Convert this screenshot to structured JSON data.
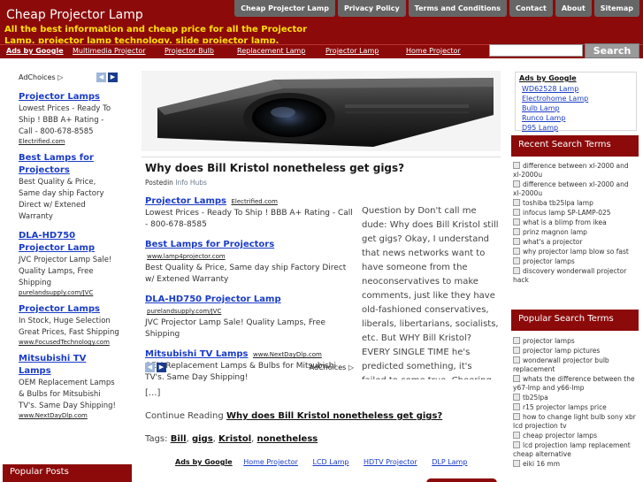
{
  "header": {
    "site_title": "Cheap Projector Lamp",
    "tagline": "All the best information and cheap price for all the Projector Lamp, projector lamp technology, slide projector lamp.",
    "top_nav": [
      "Cheap Projector Lamp",
      "Privacy Policy",
      "Terms and Conditions",
      "Contact",
      "About",
      "Sitemap"
    ]
  },
  "navbar": {
    "ads_label": "Ads by Google",
    "items": [
      "Multimedia Projector",
      "Projector Bulb",
      "Replacement Lamp",
      "Projector Lamp",
      "Home Projector"
    ],
    "search_button": "Search"
  },
  "left_sidebar": {
    "adchoices": "AdChoices",
    "arrows": [
      "◀",
      "▶"
    ],
    "ads": [
      {
        "title": "Projector Lamps",
        "body": "Lowest Prices - Ready To Ship ! BBB A+ Rating - Call - 800-678-8585",
        "url": "Electrified.com"
      },
      {
        "title": "Best Lamps for Projectors",
        "body": "Best Quality & Price, Same day ship Factory Direct w/ Extened Warranty",
        "url": ""
      },
      {
        "title": "DLA-HD750 Projector Lamp",
        "body": "JVC Projector Lamp Sale! Quality Lamps, Free Shipping",
        "url": "purelandsupply.com/JVC"
      },
      {
        "title": "Projector Lamps",
        "body": "In Stock, Huge Selection Great Prices, Fast Shipping",
        "url": "www.FocusedTechnology.com"
      },
      {
        "title": "Mitsubishi TV Lamps",
        "body": "OEM Replacement Lamps & Bulbs for Mitsubishi TV's. Same Day Shipping!",
        "url": "www.NextDayDlp.com"
      }
    ],
    "popular_posts": "Popular Posts"
  },
  "post": {
    "title": "Why does Bill Kristol nonetheless get gigs?",
    "posted_in_label": "Postedin",
    "category": "Info Hubs",
    "body": "Question by Don't call me dude: Why does Bill Kristol still get gigs? Okay, I understand that news networks want to have someone from the neoconservatives to make comments, just like they have old-fashioned conservatives, liberals, libertarians, socialists, etc. But WHY Bill Kristol? EVERY SINGLE TIME he's predicted something, it's failed to come true. Cheering",
    "ellipsis": "[...]",
    "continue_label": "Continue Reading",
    "continue_link": "Why does Bill Kristol nonetheless get gigs?",
    "tags_label": "Tags:",
    "tags": [
      "Bill",
      "gigs",
      "Kristol",
      "nonetheless"
    ]
  },
  "inline_ads": {
    "ads": [
      {
        "title": "Projector Lamps",
        "url": "Electrified.com",
        "body": "Lowest Prices - Ready To Ship ! BBB A+ Rating - Call - 800-678-8585"
      },
      {
        "title": "Best Lamps for Projectors",
        "url": "www.lamp4projector.com",
        "body": "Best Quality & Price, Same day ship Factory Direct w/ Extened Warranty"
      },
      {
        "title": "DLA-HD750 Projector Lamp",
        "url": "purelandsupply.com/JVC",
        "body": "JVC Projector Lamp Sale! Quality Lamps, Free Shipping"
      },
      {
        "title": "Mitsubishi TV Lamps",
        "url": "www.NextDayDlp.com",
        "body": "OEM Replacement Lamps & Bulbs for Mitsubishi TV's. Same Day Shipping!"
      }
    ],
    "adchoices": "AdChoices"
  },
  "bottom_links": {
    "ads_label": "Ads by Google",
    "items": [
      "Home Projector",
      "LCD Lamp",
      "HDTV Projector",
      "DLP Lamp"
    ]
  },
  "right_sidebar": {
    "ads_label": "Ads by Google",
    "ad_links": [
      "WD62528 Lamp",
      "Electrohome Lamp",
      "Bulb Lamp",
      "Runco Lamp",
      "D95 Lamp"
    ],
    "recent_title": "Recent Search Terms",
    "recent_terms": [
      "difference between xl-2000 and xl-2000u",
      "difference between xl-2000 and xl-2000u",
      "toshiba tb25lpa lamp",
      "infocus lamp SP-LAMP-025",
      "what is a blimp from ikea",
      "prinz magnon lamp",
      "what's a projector",
      "why projector lamp blow so fast",
      "projector lamps",
      "discovery wonderwall projector hack"
    ],
    "popular_title": "Popular Search Terms",
    "popular_terms": [
      "projector lamps",
      "projector lamp pictures",
      "wonderwall projector bulb replacement",
      "whats the difference between the y67-lmp and y66-lmp",
      "tb25lpa",
      "r15 projector lamps price",
      "how to change light bulb sony xbr lcd projection tv",
      "cheap projector lamps",
      "lcd projection lamp replacement cheap alternative",
      "eiki 16 mm"
    ]
  }
}
